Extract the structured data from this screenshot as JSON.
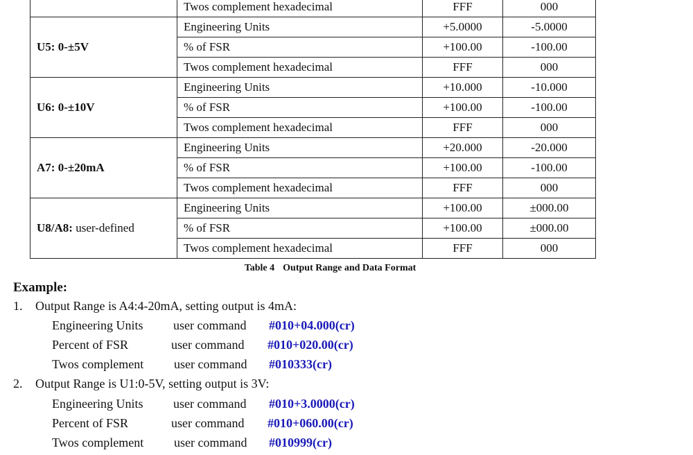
{
  "table": {
    "top_partial_row": {
      "format": "Twos complement hexadecimal",
      "max": "FFF",
      "min": "000"
    },
    "groups": [
      {
        "range_code": "U5:",
        "range_desc": "0-±5V",
        "rows": [
          {
            "format": "Engineering Units",
            "max": "+5.0000",
            "min": "-5.0000"
          },
          {
            "format": "% of FSR",
            "max": "+100.00",
            "min": "-100.00"
          },
          {
            "format": "Twos complement hexadecimal",
            "max": "FFF",
            "min": "000"
          }
        ]
      },
      {
        "range_code": "U6:",
        "range_desc": "0-±10V",
        "rows": [
          {
            "format": "Engineering Units",
            "max": "+10.000",
            "min": "-10.000"
          },
          {
            "format": "% of FSR",
            "max": "+100.00",
            "min": "-100.00"
          },
          {
            "format": "Twos complement hexadecimal",
            "max": "FFF",
            "min": "000"
          }
        ]
      },
      {
        "range_code": "A7:",
        "range_desc": "0-±20mA",
        "rows": [
          {
            "format": "Engineering Units",
            "max": "+20.000",
            "min": "-20.000"
          },
          {
            "format": "% of FSR",
            "max": "+100.00",
            "min": "-100.00"
          },
          {
            "format": "Twos complement hexadecimal",
            "max": "FFF",
            "min": "000"
          }
        ]
      },
      {
        "range_code": "U8/A8:",
        "range_desc": "user-defined",
        "rows": [
          {
            "format": "Engineering Units",
            "max": "+100.00",
            "min": "±000.00"
          },
          {
            "format": "% of FSR",
            "max": "+100.00",
            "min": "±000.00"
          },
          {
            "format": "Twos complement hexadecimal",
            "max": "FFF",
            "min": "000"
          }
        ]
      }
    ],
    "caption_number": "Table 4",
    "caption_title": "Output Range and Data Format"
  },
  "example": {
    "title": "Example:",
    "items": [
      {
        "number": "1.",
        "text": "Output Range is A4:4-20mA, setting output is 4mA:",
        "commands": [
          {
            "label": "Engineering Units",
            "type": "user command",
            "command": "#010+04.000(cr)"
          },
          {
            "label": "Percent of FSR",
            "type": "user command",
            "command": "#010+020.00(cr)"
          },
          {
            "label": "Twos complement",
            "type": "user command",
            "command": "#010333(cr)"
          }
        ]
      },
      {
        "number": "2.",
        "text": "Output Range is U1:0-5V, setting output is 3V:",
        "commands": [
          {
            "label": "Engineering Units",
            "type": "user command",
            "command": "#010+3.0000(cr)"
          },
          {
            "label": "Percent of FSR",
            "type": "user command",
            "command": "#010+060.00(cr)"
          },
          {
            "label": "Twos complement",
            "type": "user command",
            "command": "#010999(cr)"
          }
        ]
      }
    ]
  }
}
